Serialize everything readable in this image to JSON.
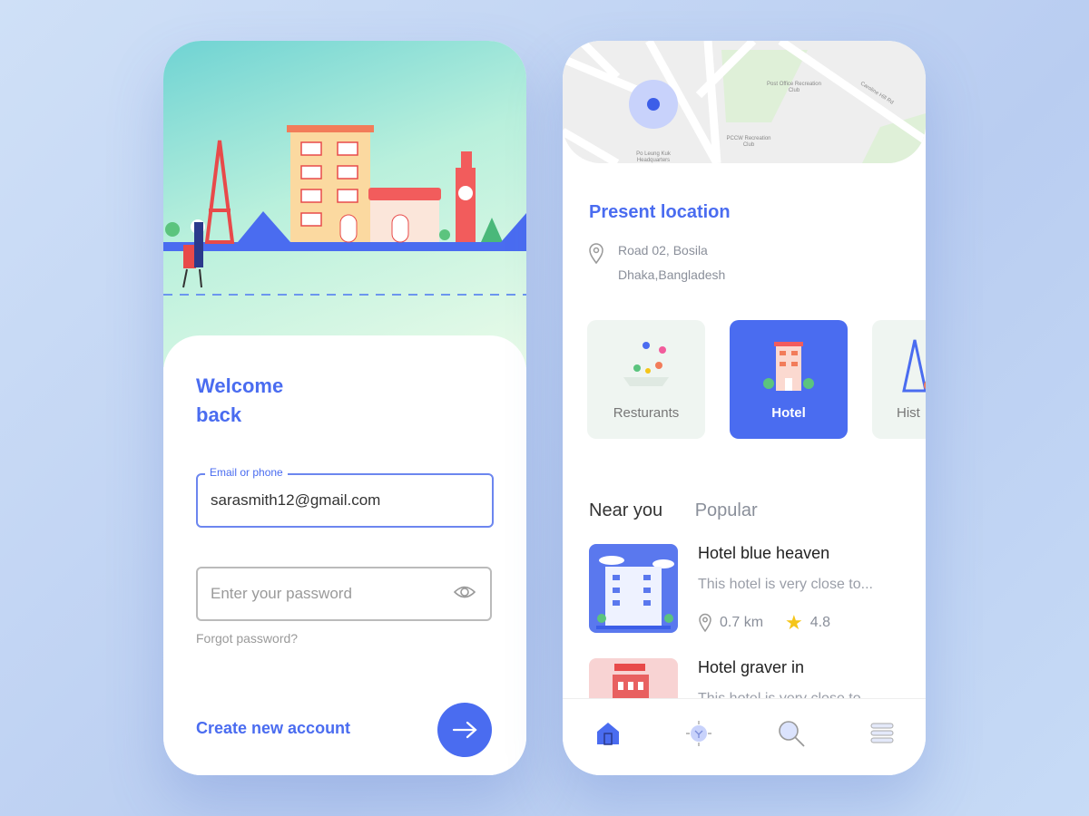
{
  "login": {
    "title_line1": "Welcome",
    "title_line2": "back",
    "email_label": "Email or phone",
    "email_value": "sarasmith12@gmail.com",
    "password_placeholder": "Enter your password",
    "forgot": "Forgot password?",
    "create_account": "Create new account",
    "icons": {
      "password": "eye-icon",
      "submit": "arrow-right-icon"
    }
  },
  "explore": {
    "map_labels": [
      "Post Office Recreation Club",
      "PCCW Recreation Club",
      "Po Leung Kuk Headquarters",
      "Caroline Hill Rd"
    ],
    "present_location": "Present location",
    "address_line1": "Road 02, Bosila",
    "address_line2": "Dhaka,Bangladesh",
    "categories": [
      {
        "label": "Resturants",
        "active": false
      },
      {
        "label": "Hotel",
        "active": true
      },
      {
        "label": "Hist",
        "active": false
      }
    ],
    "tabs": [
      {
        "label": "Near you",
        "active": true
      },
      {
        "label": "Popular",
        "active": false
      }
    ],
    "hotels": [
      {
        "name": "Hotel blue heaven",
        "desc": "This hotel is very close to...",
        "distance": "0.7 km",
        "rating": "4.8"
      },
      {
        "name": "Hotel graver in",
        "desc": "This hotel is very close to..."
      }
    ],
    "nav": [
      "home-icon",
      "explore-icon",
      "search-icon",
      "menu-icon"
    ]
  },
  "colors": {
    "accent": "#4a6cf0",
    "star": "#f5c518"
  }
}
